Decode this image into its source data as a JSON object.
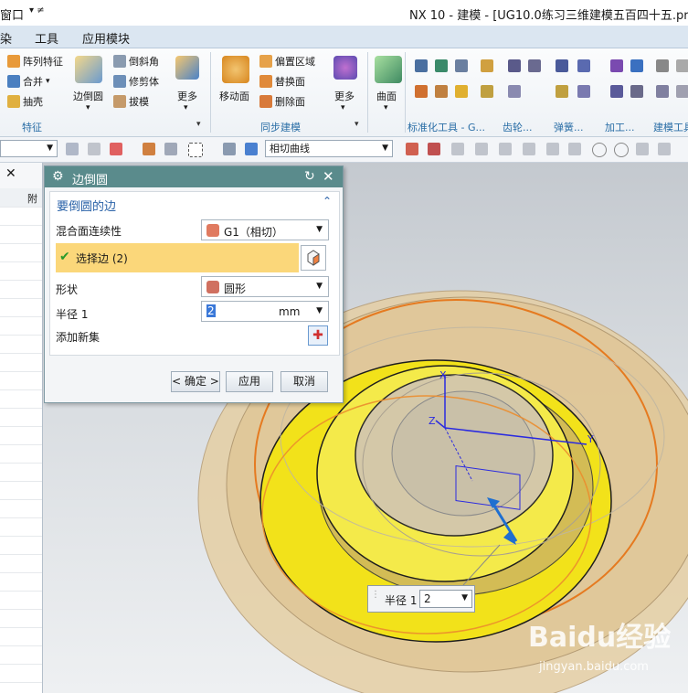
{
  "titlebar": {
    "left_fragment": "窗口",
    "title": "NX 10 - 建模 - [UG10.0练习三维建模五百四十五.prt（修"
  },
  "menubar": {
    "items": [
      "染",
      "工具",
      "应用模块"
    ]
  },
  "ribbon": {
    "feature_group": {
      "label": "特征",
      "items": [
        "阵列特征",
        "合并",
        "抽壳"
      ],
      "big_button": "边倒圆",
      "col2": [
        "倒斜角",
        "修剪体",
        "拔模"
      ],
      "more": "更多"
    },
    "sync_group": {
      "label": "同步建模",
      "big_button": "移动面",
      "items": [
        "偏置区域",
        "替换面",
        "删除面"
      ],
      "more": "更多"
    },
    "surface_group": {
      "big_button": "曲面"
    },
    "tab_labels": [
      "标准化工具 - G...",
      "齿轮...",
      "弹簧...",
      "加工...",
      "建模工具"
    ]
  },
  "toolbar2": {
    "filter_select": "",
    "curve_rule": "相切曲线"
  },
  "leftpanel": {
    "header_fragment": "附"
  },
  "dialog": {
    "title": "边倒圆",
    "section_title": "要倒圆的边",
    "blend_continuity_label": "混合面连续性",
    "blend_continuity_value": "G1（相切）",
    "select_edge_label": "选择边 (2)",
    "shape_label": "形状",
    "shape_value": "圆形",
    "radius_label": "半径 1",
    "radius_value": "2",
    "radius_unit": "mm",
    "add_new_set_label": "添加新集",
    "ok_button": "< 确定 >",
    "apply_button": "应用",
    "cancel_button": "取消"
  },
  "viewport": {
    "axis_labels": {
      "x": "X",
      "y": "Y",
      "z": "Z"
    },
    "float_radius_label": "半径 1",
    "float_radius_value": "2"
  },
  "watermark": {
    "brand": "Baidu经验",
    "url": "jingyan.baidu.com"
  }
}
